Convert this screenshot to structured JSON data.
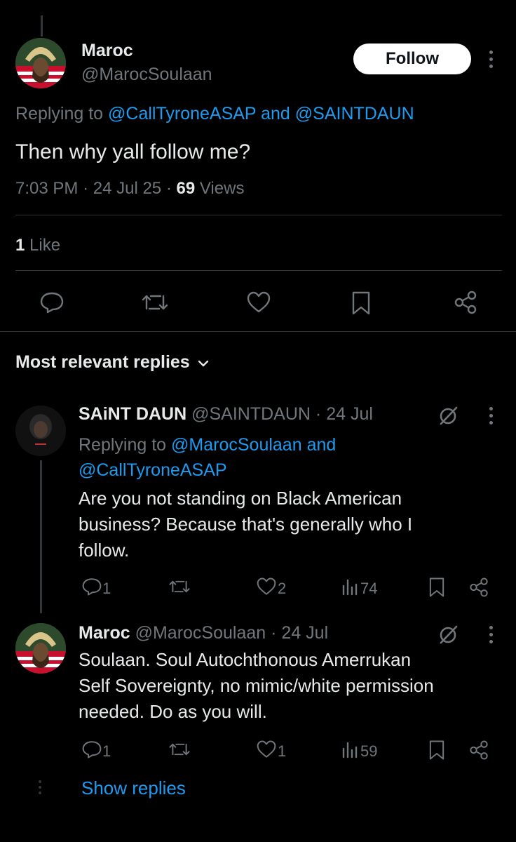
{
  "main_post": {
    "author_name": "Maroc",
    "handle": "@MarocSoulaan",
    "follow_label": "Follow",
    "replying_prefix": "Replying to",
    "replying_user1": "@CallTyroneASAP",
    "replying_and": "and",
    "replying_user2": "@SAINTDAUN",
    "text": "Then why yall follow me?",
    "time": "7:03 PM",
    "date": "24 Jul 25",
    "views_count": "69",
    "views_label": "Views",
    "likes_count": "1",
    "likes_label": "Like"
  },
  "replies_header": {
    "label": "Most relevant replies"
  },
  "replies": [
    {
      "author_name": "SAiNT DAUN",
      "handle": "@SAINTDAUN",
      "date": "24 Jul",
      "replying_prefix": "Replying to",
      "replying_user1": "@MarocSoulaan",
      "replying_and": "and",
      "replying_user2": "@CallTyroneASAP",
      "text_lines": [
        "Are you not standing on Black American",
        "business? Because that's generally who I",
        "follow."
      ],
      "reply_count": "1",
      "like_count": "2",
      "view_count": "74"
    },
    {
      "author_name": "Maroc",
      "handle": "@MarocSoulaan",
      "date": "24 Jul",
      "text_lines": [
        "Soulaan. Soul Autochthonous Amerrukan",
        "Self Sovereignty, no mimic/white permission",
        "needed. Do as you will."
      ],
      "reply_count": "1",
      "like_count": "1",
      "view_count": "59"
    }
  ],
  "show_replies_label": "Show replies",
  "colors": {
    "background": "#000000",
    "text": "#e7e9ea",
    "muted": "#71767b",
    "link": "#1d9bf0"
  }
}
